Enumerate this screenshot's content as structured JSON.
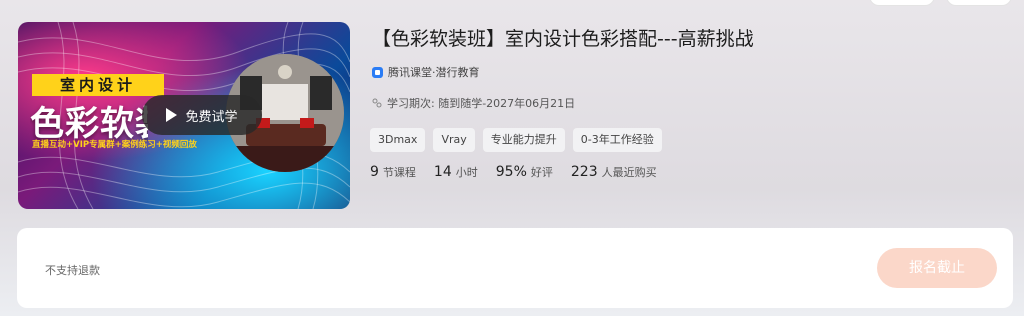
{
  "cover": {
    "badge_text": "室内设计",
    "big_title": "色彩软装",
    "sub_line": "直播互动+VIP专属群+案例练习+视频回放",
    "trial_label": "免费试学"
  },
  "course": {
    "title": "【色彩软装班】室内设计色彩搭配---高薪挑战",
    "org": "腾讯课堂·潜行教育",
    "period": "学习期次: 随到随学-2027年06月21日",
    "tags": [
      "3Dmax",
      "Vray",
      "专业能力提升",
      "0-3年工作经验"
    ],
    "stats": [
      {
        "num": "9",
        "unit": "节课程"
      },
      {
        "num": "14",
        "unit": "小时"
      },
      {
        "num": "95%",
        "unit": "好评"
      },
      {
        "num": "223",
        "unit": "人最近购买"
      }
    ]
  },
  "purchase": {
    "refund_note": "不支持退款",
    "button_label": "报名截止"
  },
  "colors": {
    "badge_yellow": "#ffd21a",
    "org_icon_blue": "#2a7cf5",
    "closed_button": "#fbd7c9"
  }
}
